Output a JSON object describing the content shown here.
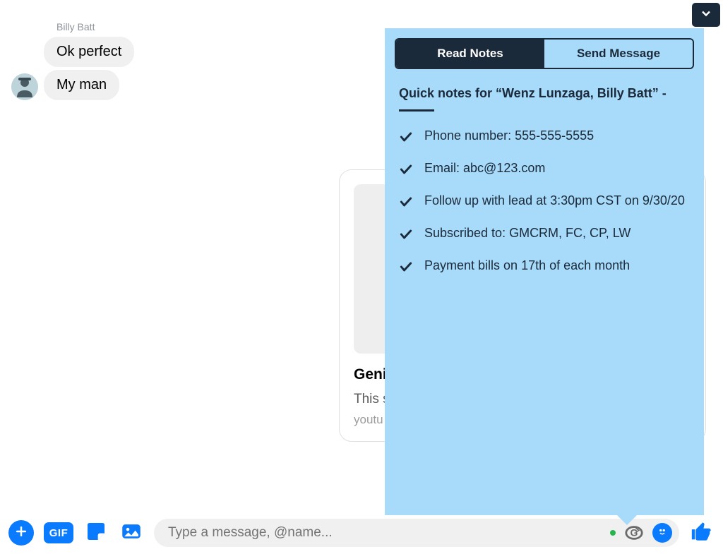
{
  "chat": {
    "sender_name": "Billy Batt",
    "messages": [
      {
        "text": "Ok perfect"
      },
      {
        "text": "My man"
      }
    ]
  },
  "link_preview": {
    "title": "Geni",
    "description": "This \nsubs",
    "domain": "youtu"
  },
  "notes": {
    "tabs": {
      "read_notes": "Read Notes",
      "send_message": "Send Message"
    },
    "title": "Quick notes for “Wenz Lunzaga, Billy Batt” -",
    "items": [
      "Phone number: 555-555-5555",
      "Email: abc@123.com",
      "Follow up with lead at 3:30pm CST on 9/30/20",
      "Subscribed to: GMCRM, FC, CP, LW",
      "Payment bills on 17th of each month"
    ]
  },
  "input": {
    "placeholder": "Type a message, @name...",
    "gif_label": "GIF"
  }
}
